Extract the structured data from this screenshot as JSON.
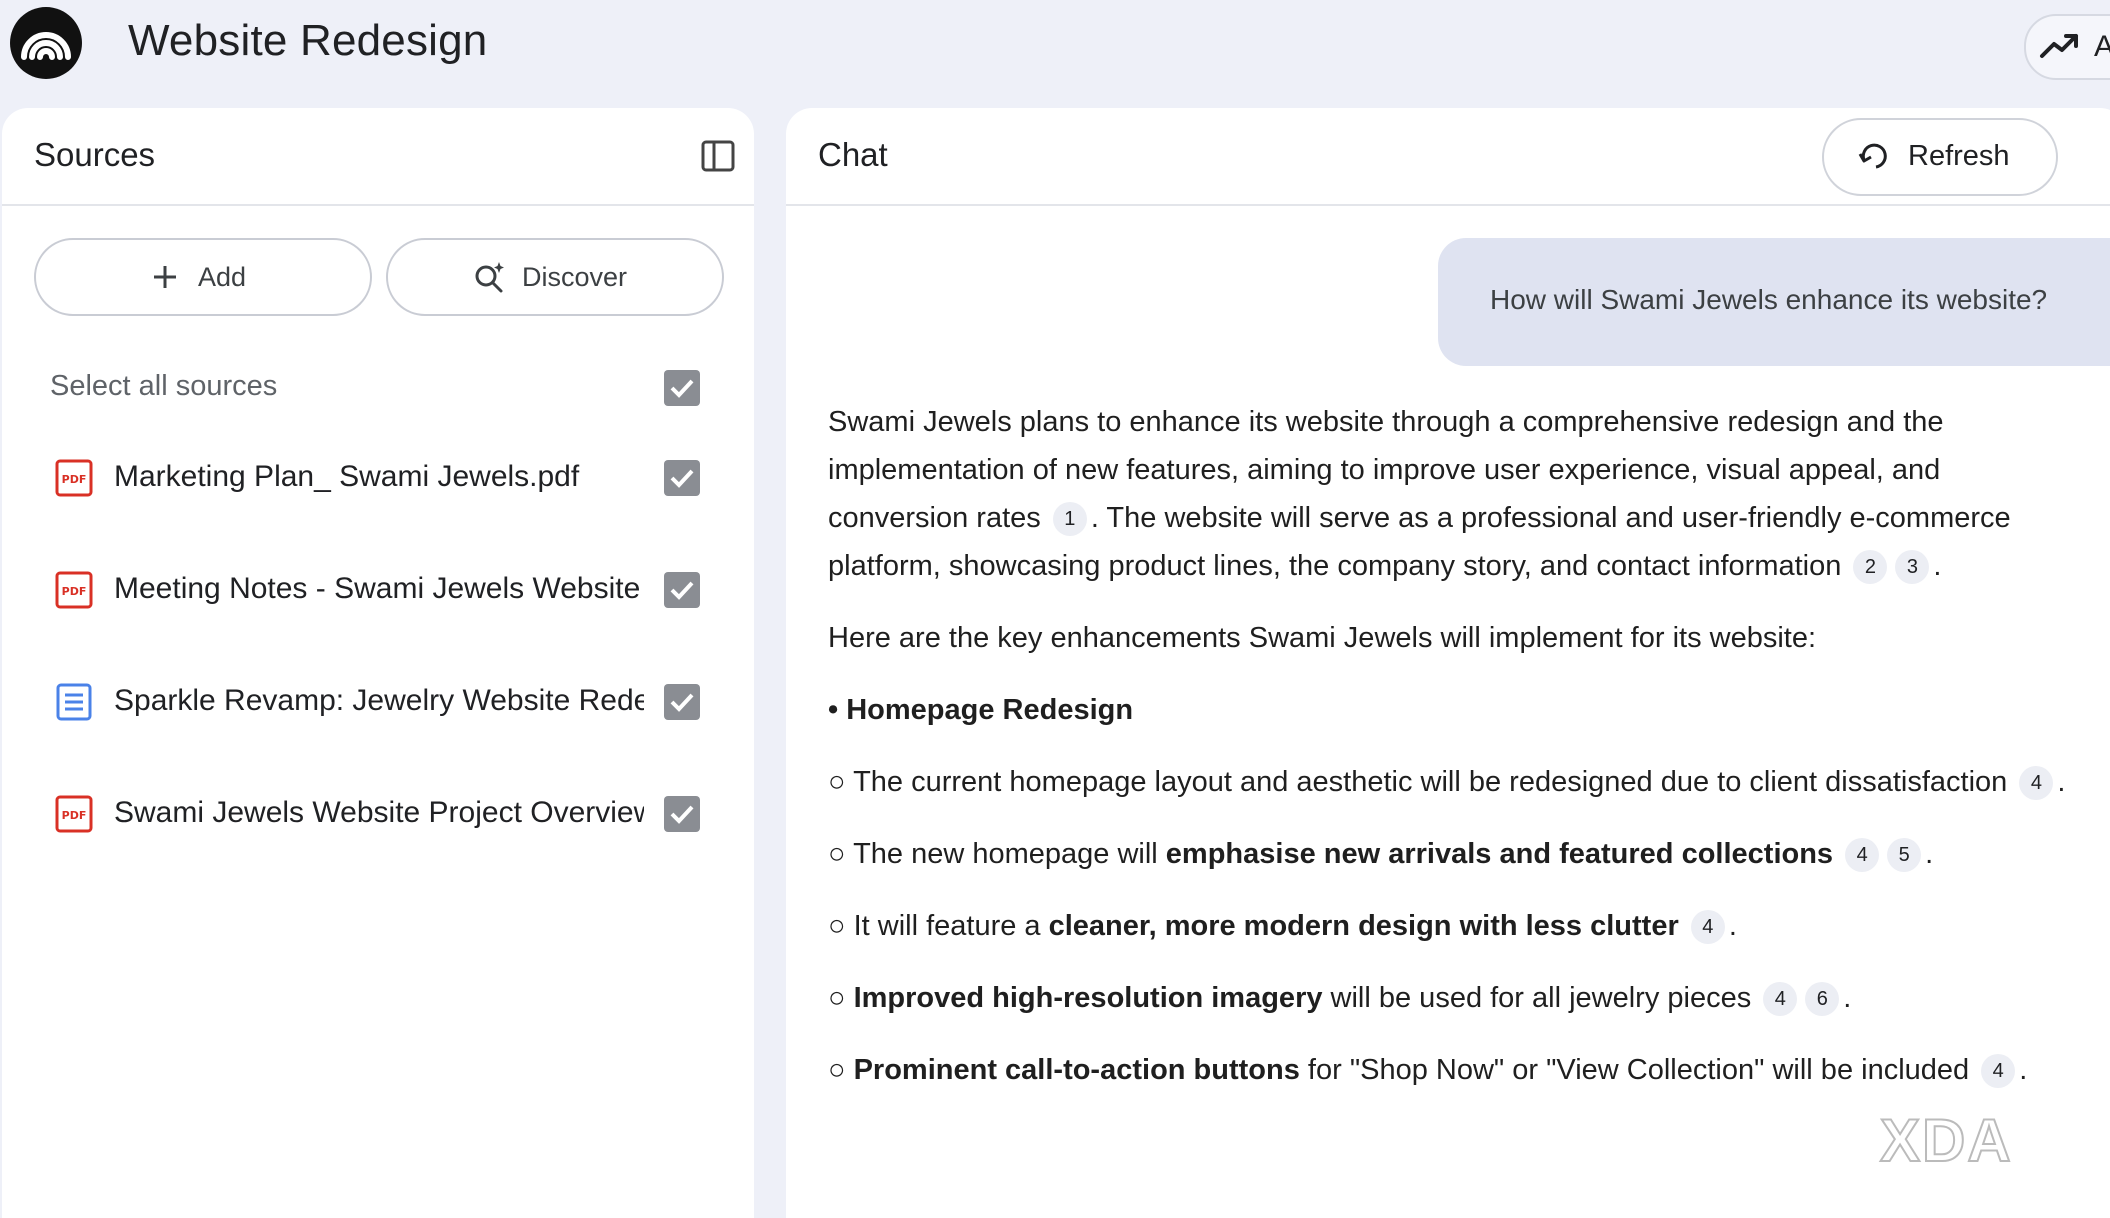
{
  "header": {
    "title": "Website Redesign",
    "analytics_label": "A"
  },
  "sources": {
    "title": "Sources",
    "add_label": "Add",
    "discover_label": "Discover",
    "select_all_label": "Select all sources",
    "items": [
      {
        "name": "Marketing Plan_ Swami Jewels.pdf",
        "type": "pdf",
        "checked": true
      },
      {
        "name": "Meeting Notes - Swami Jewels Website ...",
        "type": "pdf",
        "checked": true
      },
      {
        "name": "Sparkle Revamp: Jewelry Website Rede...",
        "type": "doc",
        "checked": true
      },
      {
        "name": "Swami Jewels Website Project Overview...",
        "type": "pdf",
        "checked": true
      }
    ]
  },
  "chat": {
    "title": "Chat",
    "refresh_label": "Refresh",
    "user_message": "How will Swami Jewels enhance its website?",
    "answer": {
      "p1_a": "Swami Jewels plans to enhance its website through a comprehensive redesign and the implementation of new features, aiming to improve user experience, visual appeal, and conversion rates",
      "p1_c1": "1",
      "p1_b": ". The website will serve as a professional and user-friendly e-commerce platform, showcasing product lines, the company story, and contact information",
      "p1_c2": "2",
      "p1_c3": "3",
      "p1_end": ".",
      "p2": "Here are the key enhancements Swami Jewels will implement for its website:",
      "h1": "Homepage Redesign",
      "s1_text": "The current homepage layout and aesthetic will be redesigned due to client dissatisfaction",
      "s1_c1": "4",
      "s2_pre": "The new homepage will ",
      "s2_bold": "emphasise new arrivals and featured collections",
      "s2_c1": "4",
      "s2_c2": "5",
      "s3_pre": "It will feature a ",
      "s3_bold": "cleaner, more modern design with less clutter",
      "s3_c1": "4",
      "s4_bold": "Improved high-resolution imagery",
      "s4_post": " will be used for all jewelry pieces",
      "s4_c1": "4",
      "s4_c2": "6",
      "s5_bold": "Prominent call-to-action buttons",
      "s5_post": " for \"Shop Now\" or \"View Collection\" will be included",
      "s5_c1": "4"
    }
  },
  "watermark": "XDA"
}
